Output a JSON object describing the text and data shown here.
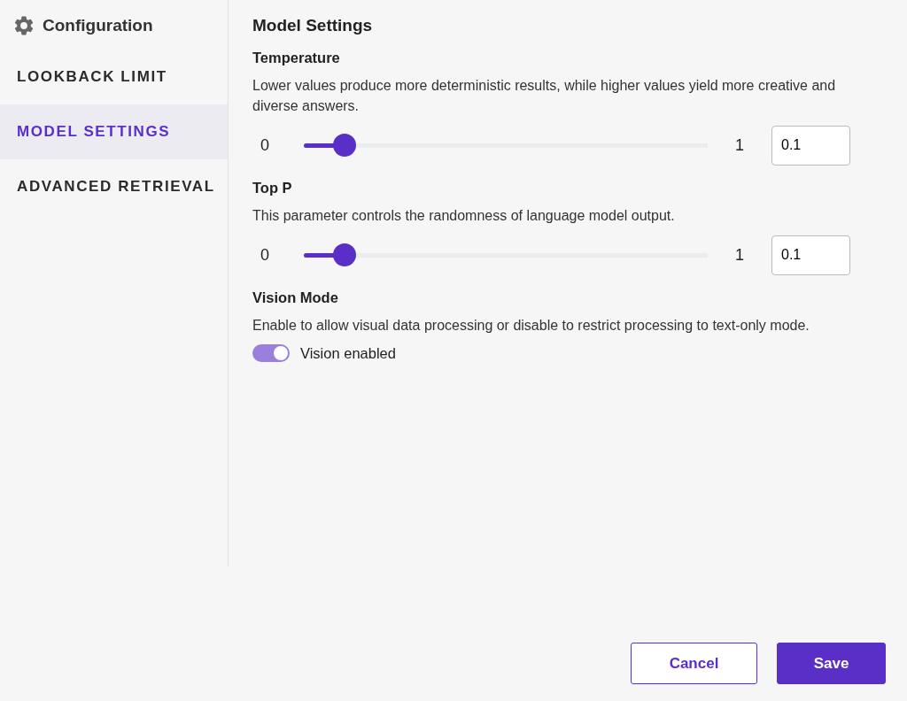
{
  "sidebar": {
    "title": "Configuration",
    "items": [
      {
        "label": "LOOKBACK LIMIT",
        "selected": false
      },
      {
        "label": "MODEL SETTINGS",
        "selected": true
      },
      {
        "label": "ADVANCED RETRIEVAL",
        "selected": false
      }
    ]
  },
  "main": {
    "title": "Model Settings",
    "settings": [
      {
        "kind": "slider",
        "label": "Temperature",
        "description": "Lower values produce more deterministic results, while higher values yield more creative and diverse answers.",
        "min_label": "0",
        "max_label": "1",
        "level": 0.1,
        "value": "0.1"
      },
      {
        "kind": "slider",
        "label": "Top P",
        "description": "This parameter controls the randomness of language model output.",
        "min_label": "0",
        "max_label": "1",
        "level": 0.1,
        "value": "0.1"
      },
      {
        "kind": "toggle",
        "label": "Vision Mode",
        "description": "Enable to allow visual data processing or disable to restrict processing to text-only mode.",
        "on": true,
        "toggle_label": "Vision enabled"
      }
    ]
  },
  "buttons": [
    {
      "label": "Cancel",
      "kind": "secondary"
    },
    {
      "label": "Save",
      "kind": "primary"
    }
  ]
}
